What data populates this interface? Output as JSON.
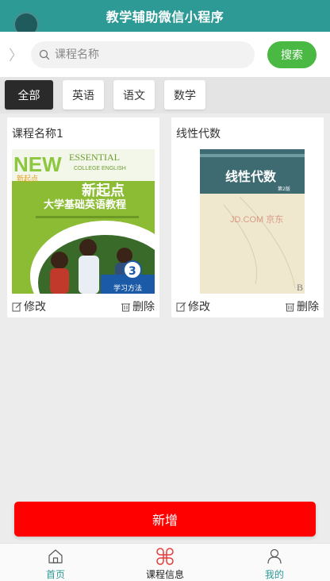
{
  "header": {
    "title": "教学辅助微信小程序"
  },
  "search": {
    "placeholder": "课程名称",
    "button_label": "搜索"
  },
  "categories": [
    {
      "label": "全部",
      "active": true
    },
    {
      "label": "英语",
      "active": false
    },
    {
      "label": "语文",
      "active": false
    },
    {
      "label": "数学",
      "active": false
    }
  ],
  "courses": [
    {
      "name": "课程名称1",
      "cover": {
        "brand_lines": [
          "NEW",
          "ESSENTIAL",
          "COLLEGE ENGLISH",
          "新起点"
        ],
        "title_cn": "新起点",
        "subtitle_cn": "大学基础英语教程",
        "badge_number": "3",
        "badge_label": "学习方法"
      },
      "edit_label": "修改",
      "delete_label": "删除"
    },
    {
      "name": "线性代数",
      "cover": {
        "title_cn": "线性代数",
        "edition": "第2版",
        "watermark": "JD.COM 京东",
        "corner_letter": "B"
      },
      "edit_label": "修改",
      "delete_label": "删除"
    }
  ],
  "add_button": {
    "label": "新增"
  },
  "tabbar": [
    {
      "label": "首页",
      "icon": "home-icon",
      "color": "#2e9a96"
    },
    {
      "label": "课程信息",
      "icon": "clover-icon",
      "color": "#222222",
      "active": true
    },
    {
      "label": "我的",
      "icon": "user-icon",
      "color": "#2e9a96"
    }
  ],
  "colors": {
    "header": "#2e9a96",
    "search_button": "#49b944",
    "add_button": "#ff0000",
    "active_tab_icon": "#e83b3b"
  }
}
